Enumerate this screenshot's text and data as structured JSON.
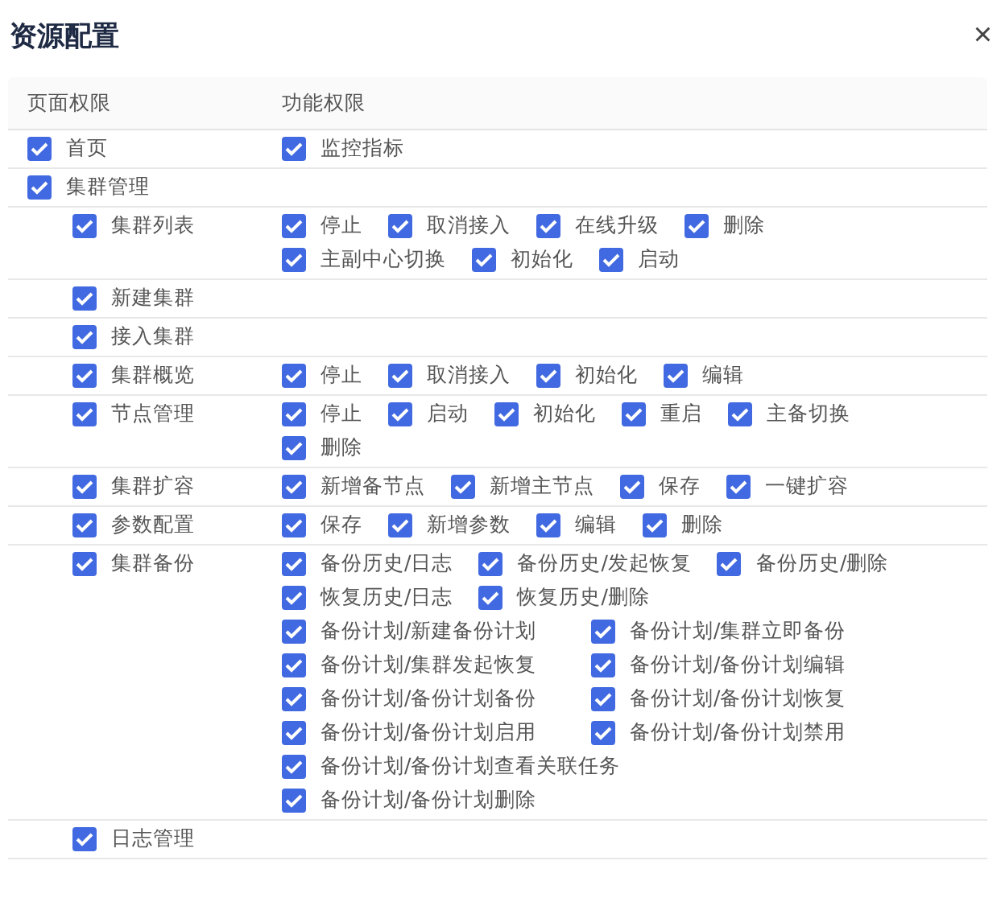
{
  "dialog": {
    "title": "资源配置",
    "close": "×"
  },
  "table": {
    "columns": [
      "页面权限",
      "功能权限"
    ],
    "pages": [
      {
        "label": "首页",
        "checked": true,
        "functions": [
          [
            {
              "label": "监控指标",
              "checked": true
            }
          ]
        ]
      },
      {
        "label": "集群管理",
        "checked": true,
        "children": [
          {
            "label": "集群列表",
            "checked": true,
            "functions": [
              [
                {
                  "label": "停止",
                  "checked": true
                },
                {
                  "label": "取消接入",
                  "checked": true
                },
                {
                  "label": "在线升级",
                  "checked": true
                },
                {
                  "label": "删除",
                  "checked": true
                }
              ],
              [
                {
                  "label": "主副中心切换",
                  "checked": true
                },
                {
                  "label": "初始化",
                  "checked": true
                },
                {
                  "label": "启动",
                  "checked": true
                }
              ]
            ]
          },
          {
            "label": "新建集群",
            "checked": true
          },
          {
            "label": "接入集群",
            "checked": true
          },
          {
            "label": "集群概览",
            "checked": true,
            "functions": [
              [
                {
                  "label": "停止",
                  "checked": true
                },
                {
                  "label": "取消接入",
                  "checked": true
                },
                {
                  "label": "初始化",
                  "checked": true
                },
                {
                  "label": "编辑",
                  "checked": true
                }
              ]
            ]
          },
          {
            "label": "节点管理",
            "checked": true,
            "functions": [
              [
                {
                  "label": "停止",
                  "checked": true
                },
                {
                  "label": "启动",
                  "checked": true
                },
                {
                  "label": "初始化",
                  "checked": true
                },
                {
                  "label": "重启",
                  "checked": true
                },
                {
                  "label": "主备切换",
                  "checked": true
                }
              ],
              [
                {
                  "label": "删除",
                  "checked": true
                }
              ]
            ]
          },
          {
            "label": "集群扩容",
            "checked": true,
            "functions": [
              [
                {
                  "label": "新增备节点",
                  "checked": true
                },
                {
                  "label": "新增主节点",
                  "checked": true
                },
                {
                  "label": "保存",
                  "checked": true
                },
                {
                  "label": "一键扩容",
                  "checked": true
                }
              ]
            ]
          },
          {
            "label": "参数配置",
            "checked": true,
            "functions": [
              [
                {
                  "label": "保存",
                  "checked": true
                },
                {
                  "label": "新增参数",
                  "checked": true
                },
                {
                  "label": "编辑",
                  "checked": true
                },
                {
                  "label": "删除",
                  "checked": true
                }
              ]
            ]
          },
          {
            "label": "集群备份",
            "checked": true,
            "functions": [
              [
                {
                  "label": "备份历史/日志",
                  "checked": true
                },
                {
                  "label": "备份历史/发起恢复",
                  "checked": true
                },
                {
                  "label": "备份历史/删除",
                  "checked": true
                }
              ],
              [
                {
                  "label": "恢复历史/日志",
                  "checked": true
                },
                {
                  "label": "恢复历史/删除",
                  "checked": true
                }
              ],
              [
                {
                  "label": "备份计划/新建备份计划",
                  "checked": true
                },
                {
                  "label": "备份计划/集群立即备份",
                  "checked": true
                }
              ],
              [
                {
                  "label": "备份计划/集群发起恢复",
                  "checked": true
                },
                {
                  "label": "备份计划/备份计划编辑",
                  "checked": true
                }
              ],
              [
                {
                  "label": "备份计划/备份计划备份",
                  "checked": true
                },
                {
                  "label": "备份计划/备份计划恢复",
                  "checked": true
                }
              ],
              [
                {
                  "label": "备份计划/备份计划启用",
                  "checked": true
                },
                {
                  "label": "备份计划/备份计划禁用",
                  "checked": true
                }
              ],
              [
                {
                  "label": "备份计划/备份计划查看关联任务",
                  "checked": true
                }
              ],
              [
                {
                  "label": "备份计划/备份计划删除",
                  "checked": true
                }
              ]
            ]
          },
          {
            "label": "日志管理",
            "checked": true
          }
        ]
      }
    ]
  }
}
